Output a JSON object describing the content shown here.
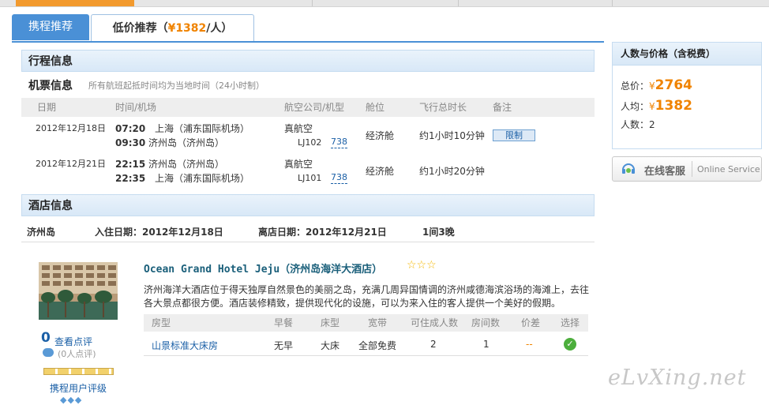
{
  "tabs": {
    "tab1": "携程推荐",
    "tab2_prefix": "低价推荐（",
    "tab2_price": "¥1382",
    "tab2_suffix": "/人）"
  },
  "trip": {
    "title": "行程信息",
    "tickets_title": "机票信息",
    "tickets_note": "所有航班起抵时间均为当地时间（24小时制）"
  },
  "flight_headers": {
    "date": "日期",
    "time_airport": "时间/机场",
    "airline": "航空公司/机型",
    "cabin": "舱位",
    "duration": "飞行总时长",
    "remark": "备注"
  },
  "flights": [
    {
      "date": "2012年12月18日",
      "dep_time": "07:20",
      "dep_airport": "上海（浦东国际机场）",
      "arr_time": "09:30",
      "arr_airport": "济州岛（济州岛）",
      "airline": "真航空",
      "flight_no": "LJ102",
      "aircraft": "738",
      "cabin": "经济舱",
      "duration": "约1小时10分钟",
      "remark": "限制"
    },
    {
      "date": "2012年12月21日",
      "dep_time": "22:15",
      "dep_airport": "济州岛（济州岛）",
      "arr_time": "22:35",
      "arr_airport": "上海（浦东国际机场）",
      "airline": "真航空",
      "flight_no": "LJ101",
      "aircraft": "738",
      "cabin": "经济舱",
      "duration": "约1小时20分钟",
      "remark": ""
    }
  ],
  "hotel_section": {
    "title": "酒店信息",
    "city": "济州岛",
    "checkin": "入住日期：2012年12月18日",
    "checkout": "离店日期：2012年12月21日",
    "nights": "1间3晚"
  },
  "hotel": {
    "name": "Ocean Grand Hotel Jeju（济州岛海洋大酒店）",
    "stars": "☆☆☆",
    "desc1": "济州海洋大酒店位于得天独厚自然景色的美丽之岛，充满几周异国情调的济州咸德海滨浴场的海滩上，去往",
    "desc2": "各大景点都很方便。酒店装修精致，提供现代化的设施，可以为来入住的客人提供一个美好的假期。",
    "review_count": "0",
    "review_link": "查看点评",
    "review_sub": "(0人点评)",
    "rating_label": "携程用户评级"
  },
  "room_headers": {
    "type": "房型",
    "breakfast": "早餐",
    "bed": "床型",
    "broadband": "宽带",
    "adults": "可住成人数",
    "rooms": "房间数",
    "diff": "价差",
    "select": "选择"
  },
  "room": {
    "type": "山景标准大床房",
    "breakfast": "无早",
    "bed": "大床",
    "broadband": "全部免费",
    "adults": "2",
    "rooms": "1",
    "diff": "--"
  },
  "summary": {
    "title": "人数与价格（含税费）",
    "total_label": "总价：",
    "total": "2764",
    "per_label": "人均：",
    "per": "1382",
    "people_label": "人数：",
    "people": "2",
    "yen": "¥"
  },
  "service": {
    "cn": "在线客服",
    "en": "Online Service"
  },
  "watermark": "eLvXing.net",
  "colors": {
    "accent": "#4a90d6",
    "price": "#f08300",
    "progress": "#f29a2e"
  }
}
